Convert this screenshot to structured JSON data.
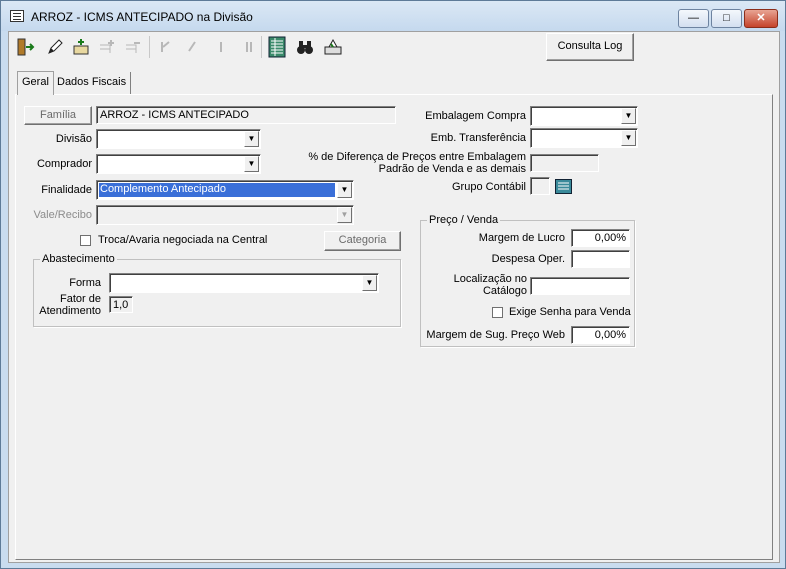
{
  "window": {
    "title": "ARROZ - ICMS ANTECIPADO na Divisão",
    "minimize": "—",
    "maximize": "□",
    "close": "✕"
  },
  "toolbar": {
    "icons": [
      "exit-door-icon",
      "edit-pencil-icon",
      "add-record-icon",
      "insert-icon-disabled",
      "delete-icon-disabled",
      "first-record-icon-disabled",
      "previous-record-icon-disabled",
      "next-record-icon-disabled",
      "last-record-icon-disabled",
      "grid-list-icon",
      "binoculars-search-icon",
      "print-icon"
    ],
    "consulta_log": "Consulta Log"
  },
  "tabs": [
    {
      "label": "Geral",
      "active": true
    },
    {
      "label": "Dados Fiscais",
      "active": false
    }
  ],
  "geral": {
    "familia_button": "Família",
    "familia_value": "ARROZ - ICMS ANTECIPADO",
    "divisao_label": "Divisão",
    "divisao_value": "",
    "comprador_label": "Comprador",
    "comprador_value": "",
    "finalidade_label": "Finalidade",
    "finalidade_value": "Complemento Antecipado",
    "vale_recibo_label": "Vale/Recibo",
    "vale_recibo_value": "",
    "troca_avaria_label": "Troca/Avaria negociada na Central",
    "troca_avaria_checked": false,
    "categoria_button": "Categoria",
    "embalagem_compra_label": "Embalagem Compra",
    "embalagem_compra_value": "",
    "emb_transferencia_label": "Emb. Transferência",
    "emb_transferencia_value": "",
    "perc_diferenca_label_1": "% de Diferença de Preços entre Embalagem",
    "perc_diferenca_label_2": "Padrão de Venda e as demais",
    "perc_diferenca_value": "",
    "grupo_contabil_label": "Grupo Contábil",
    "grupo_contabil_value": ""
  },
  "abastecimento": {
    "title": "Abastecimento",
    "forma_label": "Forma",
    "forma_value": "",
    "fator_label_1": "Fator de",
    "fator_label_2": "Atendimento",
    "fator_value": "1,0"
  },
  "preco_venda": {
    "title": "Preço / Venda",
    "margem_lucro_label": "Margem de Lucro",
    "margem_lucro_value": "0,00%",
    "despesa_oper_label": "Despesa Oper.",
    "despesa_oper_value": "",
    "localizacao_label_1": "Localização no",
    "localizacao_label_2": "Catálogo",
    "localizacao_value": "",
    "exige_senha_label": "Exige Senha para Venda",
    "exige_senha_checked": false,
    "margem_sug_label": "Margem de Sug. Preço Web",
    "margem_sug_value": "0,00%"
  }
}
